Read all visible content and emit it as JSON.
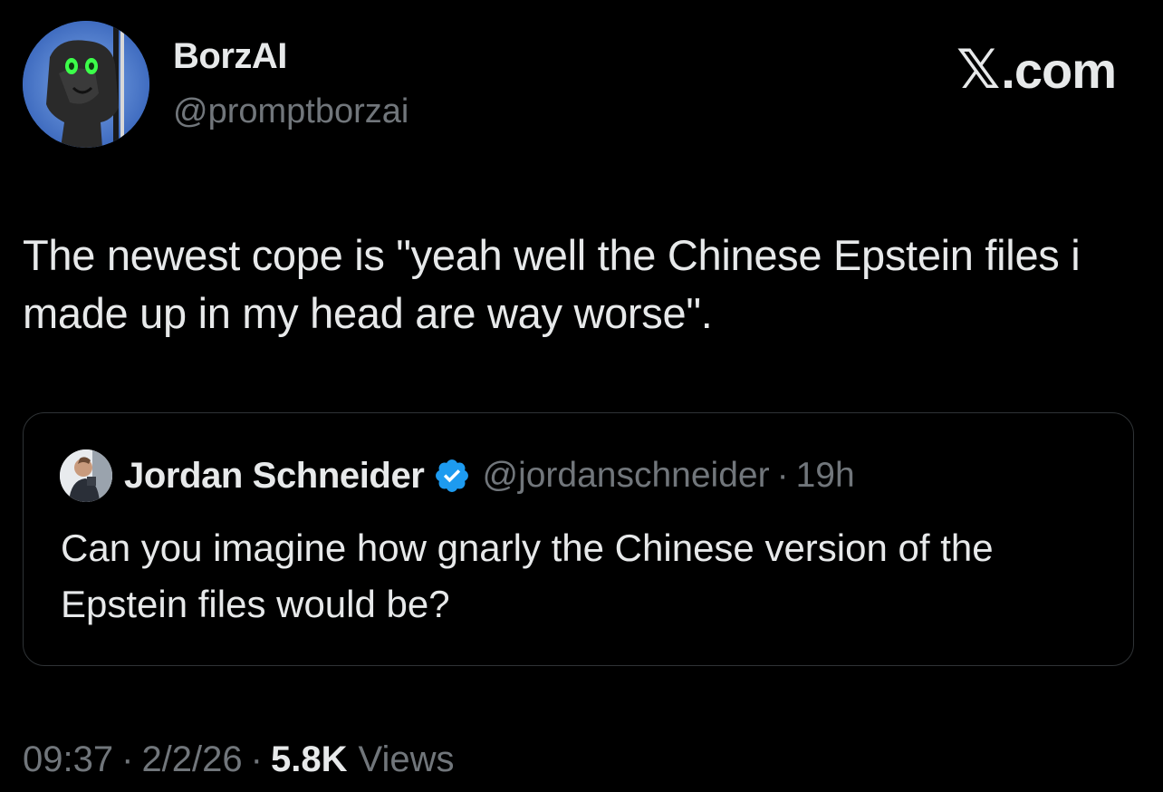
{
  "author": {
    "display_name": "BorzAI",
    "handle": "@promptborzai"
  },
  "brand": {
    "mark": "𝕏",
    "domain": ".com"
  },
  "tweet": {
    "text": "The newest cope is \"yeah well the Chinese Epstein files i made up in my head are way worse\"."
  },
  "quoted_tweet": {
    "display_name": "Jordan Schneider",
    "verified": true,
    "handle": "@jordanschneider",
    "separator": "·",
    "time": "19h",
    "text": "Can you imagine how gnarly the Chinese version of the Epstein files would be?"
  },
  "meta": {
    "time": "09:37",
    "date": "2/2/26",
    "separator": "·",
    "views_count": "5.8K",
    "views_label": "Views"
  },
  "colors": {
    "background": "#000000",
    "primary_text": "#e7e9ea",
    "secondary_text": "#71767b",
    "border": "#2f3336",
    "verified_blue": "#1d9bf0"
  },
  "icons": {
    "verified": "verified-badge-icon",
    "brand": "x-logo-icon"
  }
}
